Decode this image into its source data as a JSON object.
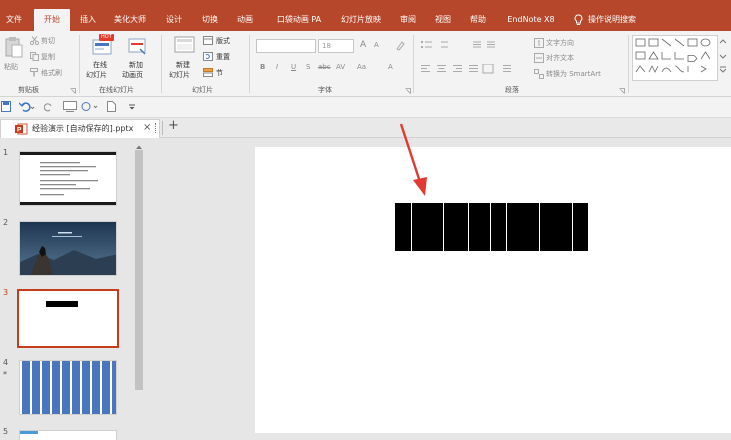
{
  "ribbon_tabs": [
    {
      "label": "文件",
      "active": false
    },
    {
      "label": "开始",
      "active": true
    },
    {
      "label": "插入",
      "active": false
    },
    {
      "label": "美化大师",
      "active": false
    },
    {
      "label": "设计",
      "active": false
    },
    {
      "label": "切换",
      "active": false
    },
    {
      "label": "动画",
      "active": false
    },
    {
      "label": "口袋动画 PA",
      "active": false
    },
    {
      "label": "幻灯片放映",
      "active": false
    },
    {
      "label": "审阅",
      "active": false
    },
    {
      "label": "视图",
      "active": false
    },
    {
      "label": "帮助",
      "active": false
    },
    {
      "label": "EndNote X8",
      "active": false
    },
    {
      "label": "操作说明搜索",
      "active": false
    }
  ],
  "clipboard": {
    "paste": "粘贴",
    "cut": "剪切",
    "copy": "复制",
    "format_painter": "格式刷",
    "group": "剪贴板"
  },
  "online_slides": {
    "hot_badge": "HOT",
    "online_slide_line1": "在线",
    "online_slide_line2": "幻灯片",
    "new_animation_line1": "新加",
    "new_animation_line2": "动画页",
    "group": "在线幻灯片"
  },
  "slides_group": {
    "new_slide_line1": "新建",
    "new_slide_line2": "幻灯片",
    "layout": "版式",
    "reset": "重置",
    "section": "节",
    "group": "幻灯片"
  },
  "font_group": {
    "font_name": "",
    "font_size": "18",
    "grow": "A",
    "shrink": "A",
    "bold": "B",
    "italic": "I",
    "underline": "U",
    "shadow": "S",
    "strike": "abc",
    "spacing": "AV",
    "case": "Aa",
    "color": "A",
    "group": "字体"
  },
  "paragraph_group": {
    "text_direction": "文字方向",
    "align_text": "对齐文本",
    "smartart": "转换为 SmartArt",
    "group": "段落"
  },
  "document_tab": {
    "name": "经验演示 [自动保存的].pptx",
    "close": "×",
    "add": "+"
  },
  "slides": [
    {
      "number": "1",
      "selected": false
    },
    {
      "number": "2",
      "selected": false
    },
    {
      "number": "3",
      "selected": true
    },
    {
      "number": "4",
      "selected": false,
      "star": "*"
    },
    {
      "number": "5",
      "selected": false
    }
  ],
  "colors": {
    "accent": "#b7472a",
    "arrow": "#e03a32",
    "thumb_blue": "#4a76c0",
    "selected_border": "#c43e1c"
  }
}
